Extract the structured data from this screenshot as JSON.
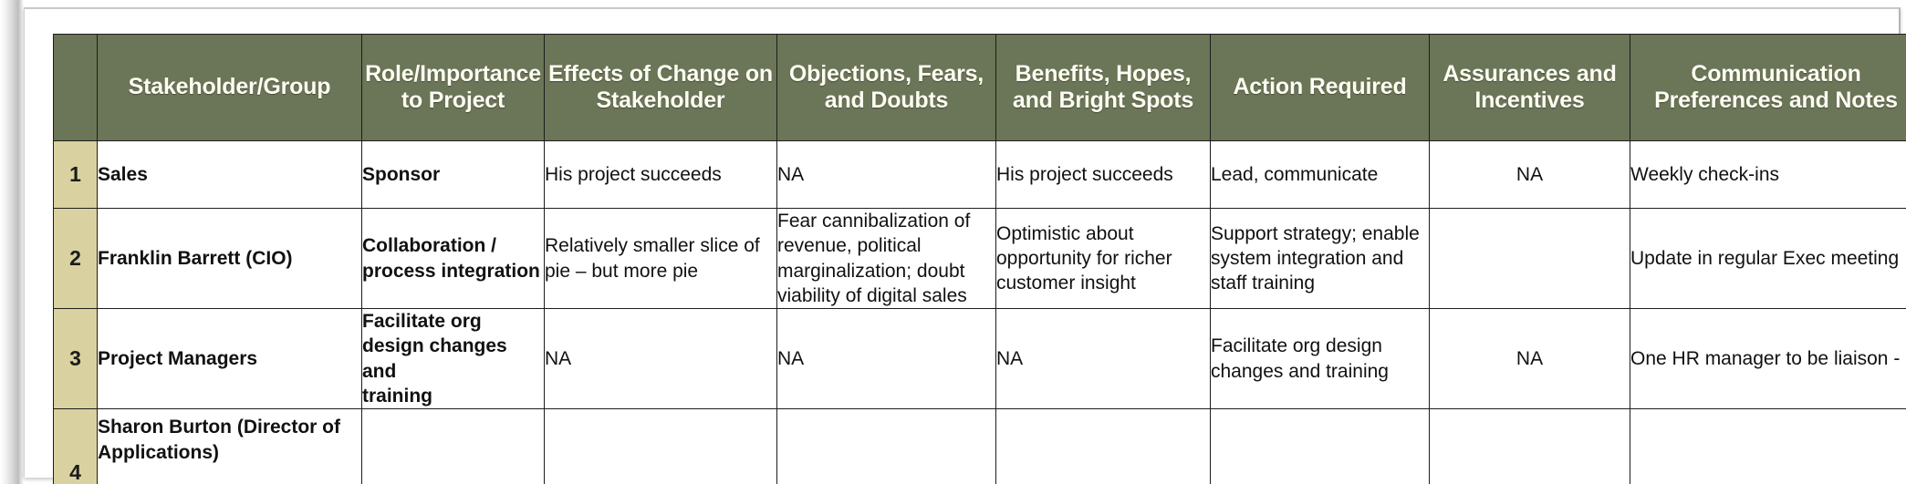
{
  "theme": {
    "header_bg": "#6b7557",
    "header_text": "#fdfdf2",
    "rownum_bg": "#d9d2a0",
    "cell_bg": "#ffffff",
    "cell_text": "#111111",
    "grid_line": "#1d1d1d"
  },
  "table": {
    "row_number_header": "",
    "columns": [
      {
        "key": "stakeholder",
        "label": "Stakeholder/Group"
      },
      {
        "key": "role",
        "label": "Role/Importance\nto Project"
      },
      {
        "key": "effects",
        "label": "Effects of Change on\nStakeholder"
      },
      {
        "key": "objections",
        "label": "Objections, Fears,\nand Doubts"
      },
      {
        "key": "benefits",
        "label": "Benefits, Hopes,\nand Bright Spots"
      },
      {
        "key": "action",
        "label": "Action Required"
      },
      {
        "key": "assurances",
        "label": "Assurances and\nIncentives"
      },
      {
        "key": "communication",
        "label": "Communication\nPreferences and Notes"
      }
    ],
    "rows": [
      {
        "number": "1",
        "stakeholder": "Sales",
        "role": "Sponsor",
        "effects": "His project succeeds",
        "objections": "NA",
        "benefits": "His project succeeds",
        "action": "Lead, communicate",
        "assurances": "NA",
        "communication": "Weekly check-ins"
      },
      {
        "number": "2",
        "stakeholder": "Franklin Barrett (CIO)",
        "role": "Collaboration /\nprocess integration",
        "effects": "Relatively smaller slice of\npie – but more pie",
        "objections": "Fear cannibalization of\nrevenue, political\nmarginalization; doubt\nviability of digital sales",
        "benefits": "Optimistic about\nopportunity for richer\ncustomer insight",
        "action": "Support strategy; enable\nsystem integration and\nstaff training",
        "assurances": "",
        "communication": "Update in regular Exec meeting"
      },
      {
        "number": "3",
        "stakeholder": "Project Managers",
        "role": "Facilitate org\ndesign changes and\ntraining",
        "effects": "NA",
        "objections": "NA",
        "benefits": "NA",
        "action": "Facilitate org design\nchanges and training",
        "assurances": "NA",
        "communication": "One HR manager to be liaison -"
      },
      {
        "number": "4",
        "stakeholder": "Sharon Burton (Director of\nApplications)",
        "role": "",
        "effects": "",
        "objections": "",
        "benefits": "",
        "action": "",
        "assurances": "",
        "communication": ""
      }
    ],
    "cell_alignment": {
      "assurances": "center"
    },
    "bold_columns": [
      "stakeholder",
      "role"
    ]
  }
}
